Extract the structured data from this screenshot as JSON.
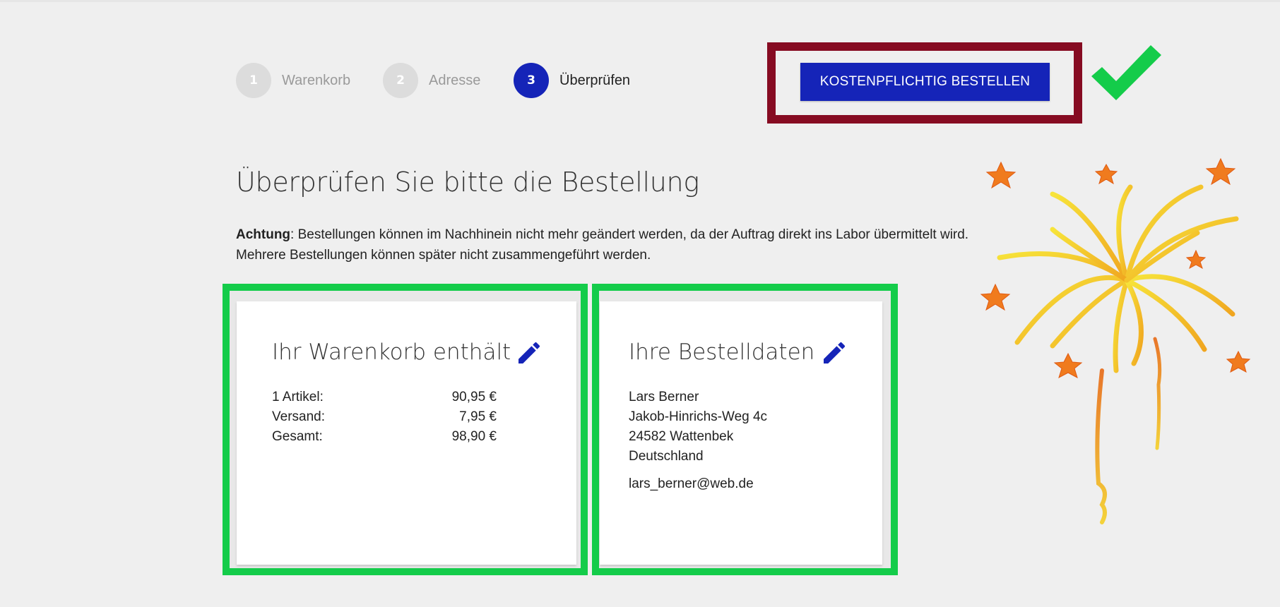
{
  "steps": [
    {
      "number": "1",
      "label": "Warenkorb"
    },
    {
      "number": "2",
      "label": "Adresse"
    },
    {
      "number": "3",
      "label": "Überprüfen"
    }
  ],
  "order_button_label": "KOSTENPFLICHTIG BESTELLEN",
  "page_title": "Überprüfen Sie bitte die Bestellung",
  "notice": {
    "bold": "Achtung",
    "line1": ": Bestellungen können im Nachhinein nicht mehr geändert werden, da der Auftrag direkt ins Labor übermittelt wird.",
    "line2": "Mehrere Bestellungen können später nicht zusammengeführt werden."
  },
  "cart_card": {
    "title": "Ihr Warenkorb enthält",
    "rows": [
      {
        "label": "1 Artikel:",
        "value": "90,95 €"
      },
      {
        "label": "Versand:",
        "value": "7,95 €"
      },
      {
        "label": "Gesamt:",
        "value": "98,90 €"
      }
    ]
  },
  "order_card": {
    "title": "Ihre Bestelldaten",
    "name": "Lars Berner",
    "street": "Jakob-Hinrichs-Weg 4c",
    "city": "24582 Wattenbek",
    "country": "Deutschland",
    "email": "lars_berner@web.de"
  },
  "colors": {
    "accent": "#1524b8",
    "highlight_frame": "#860b22",
    "card_frame": "#14cc4a",
    "checkmark": "#14cc4a"
  },
  "icons": [
    "pencil-icon",
    "checkmark-icon",
    "fireworks-illustration"
  ]
}
